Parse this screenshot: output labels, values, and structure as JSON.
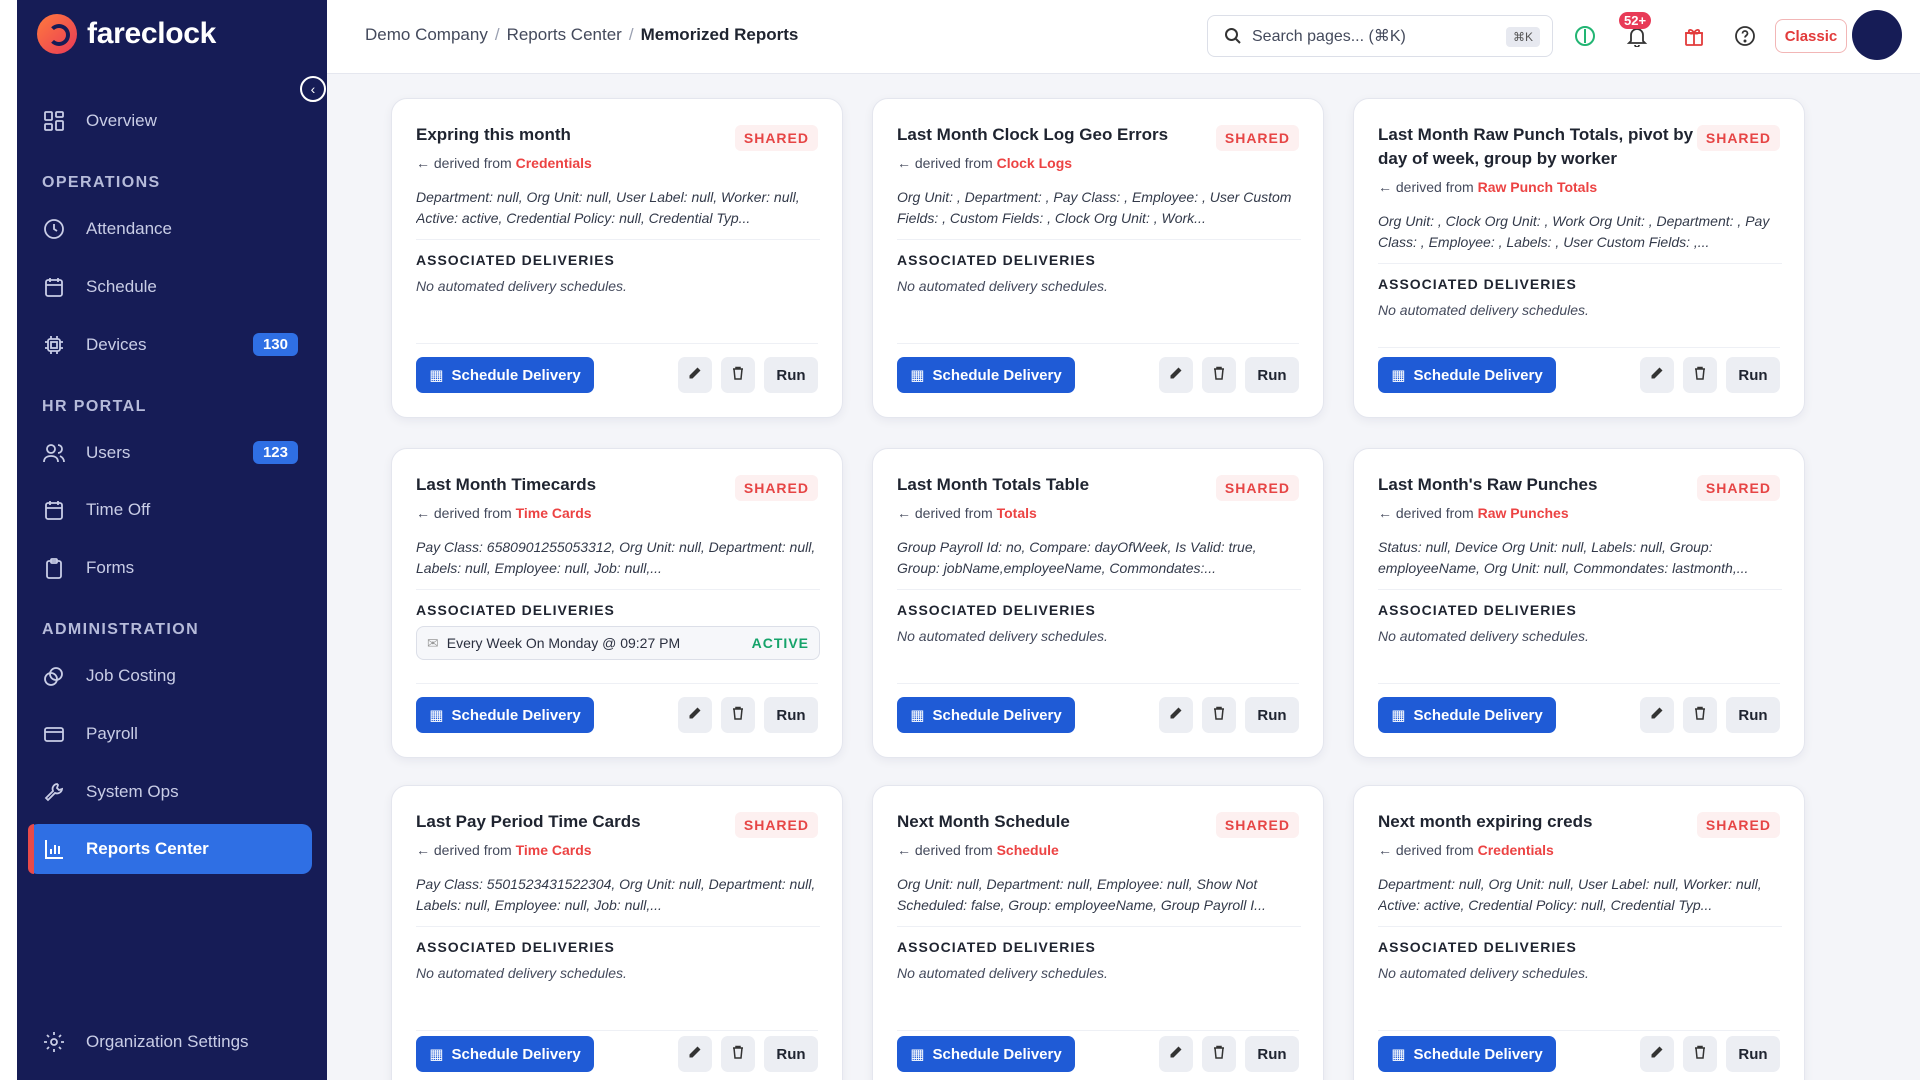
{
  "app": {
    "name": "fareclock"
  },
  "sidebar": {
    "overview": "Overview",
    "sections": [
      "OPERATIONS",
      "HR PORTAL",
      "ADMINISTRATION"
    ],
    "items": [
      {
        "label": "Attendance"
      },
      {
        "label": "Schedule"
      },
      {
        "label": "Devices",
        "badge": "130"
      },
      {
        "label": "Users",
        "badge": "123"
      },
      {
        "label": "Time Off"
      },
      {
        "label": "Forms"
      },
      {
        "label": "Job Costing"
      },
      {
        "label": "Payroll"
      },
      {
        "label": "System Ops"
      },
      {
        "label": "Reports Center"
      }
    ],
    "settings": "Organization Settings"
  },
  "header": {
    "breadcrumb": [
      "Demo Company",
      "Reports Center",
      "Memorized Reports"
    ],
    "search_placeholder": "Search pages... (⌘K)",
    "search_kbd": "⌘K",
    "notifications": "52+",
    "classic": "Classic"
  },
  "labels": {
    "shared": "SHARED",
    "derived_prefix": "derived from",
    "assoc_title": "ASSOCIATED DELIVERIES",
    "no_delivery": "No automated delivery schedules.",
    "schedule_btn": "Schedule Delivery",
    "run_btn": "Run",
    "active": "ACTIVE"
  },
  "cards": [
    {
      "title": "Expring this month",
      "source": "Credentials",
      "desc": "Department: null, Org Unit: null, User Label: null, Worker: null, Active: active, Credential Policy: null, Credential Typ..."
    },
    {
      "title": "Last Month Clock Log Geo Errors",
      "source": "Clock Logs",
      "desc": "Org Unit: , Department: , Pay Class: , Employee: , User Custom Fields: , Custom Fields: , Clock Org Unit: , Work..."
    },
    {
      "title": "Last Month Raw Punch Totals, pivot by day of week, group by worker",
      "source": "Raw Punch Totals",
      "desc": "Org Unit: , Clock Org Unit: , Work Org Unit: , Department: , Pay Class: , Employee: , Labels: , User Custom Fields: ,..."
    },
    {
      "title": "Last Month Timecards",
      "source": "Time Cards",
      "desc": "Pay Class: 6580901255053312, Org Unit: null, Department: null, Labels: null, Employee: null, Job: null,...",
      "delivery": "Every Week On Monday @ 09:27 PM"
    },
    {
      "title": "Last Month Totals Table",
      "source": "Totals",
      "desc": "Group Payroll Id: no, Compare: dayOfWeek, Is Valid: true, Group: jobName,employeeName, Commondates:..."
    },
    {
      "title": "Last Month's Raw Punches",
      "source": "Raw Punches",
      "desc": "Status: null, Device Org Unit: null, Labels: null, Group: employeeName, Org Unit: null, Commondates: lastmonth,..."
    },
    {
      "title": "Last Pay Period Time Cards",
      "source": "Time Cards",
      "desc": "Pay Class: 5501523431522304, Org Unit: null, Department: null, Labels: null, Employee: null, Job: null,..."
    },
    {
      "title": "Next Month Schedule",
      "source": "Schedule",
      "desc": "Org Unit: null, Department: null, Employee: null, Show Not Scheduled: false, Group: employeeName, Group Payroll I..."
    },
    {
      "title": "Next month expiring creds",
      "source": "Credentials",
      "desc": "Department: null, Org Unit: null, User Label: null, Worker: null, Active: active, Credential Policy: null, Credential Typ..."
    }
  ]
}
